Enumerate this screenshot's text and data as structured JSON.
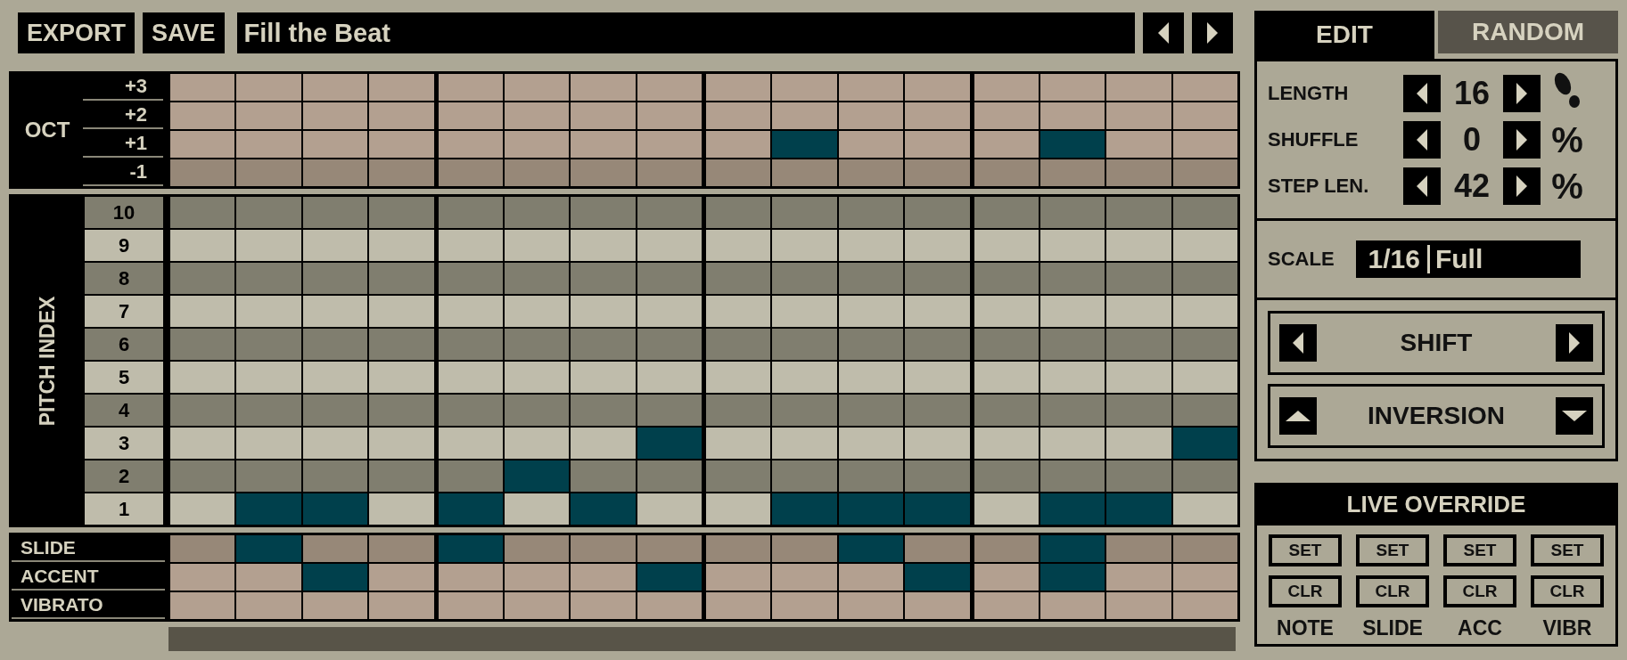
{
  "toolbar": {
    "buttons": [
      "EXPORT",
      "SAVE"
    ],
    "pattern_name": "Fill the Beat"
  },
  "octave": {
    "label": "OCT",
    "rows": [
      {
        "label": "+3",
        "kind": "light",
        "steps": [
          false,
          false,
          false,
          false,
          false,
          false,
          false,
          false,
          false,
          false,
          false,
          false,
          false,
          false,
          false,
          false
        ]
      },
      {
        "label": "+2",
        "kind": "light",
        "steps": [
          false,
          false,
          false,
          false,
          false,
          false,
          false,
          false,
          false,
          false,
          false,
          false,
          false,
          false,
          false,
          false
        ]
      },
      {
        "label": "+1",
        "kind": "light",
        "steps": [
          false,
          false,
          false,
          false,
          false,
          false,
          false,
          false,
          false,
          true,
          false,
          false,
          false,
          true,
          false,
          false
        ]
      },
      {
        "label": "-1",
        "kind": "dark",
        "steps": [
          false,
          false,
          false,
          false,
          false,
          false,
          false,
          false,
          false,
          false,
          false,
          false,
          false,
          false,
          false,
          false
        ]
      }
    ]
  },
  "pitch": {
    "label": "PITCH INDEX",
    "rows": [
      {
        "label": "10",
        "kind": "dark",
        "steps": [
          false,
          false,
          false,
          false,
          false,
          false,
          false,
          false,
          false,
          false,
          false,
          false,
          false,
          false,
          false,
          false
        ]
      },
      {
        "label": "9",
        "kind": "light",
        "steps": [
          false,
          false,
          false,
          false,
          false,
          false,
          false,
          false,
          false,
          false,
          false,
          false,
          false,
          false,
          false,
          false
        ]
      },
      {
        "label": "8",
        "kind": "dark",
        "steps": [
          false,
          false,
          false,
          false,
          false,
          false,
          false,
          false,
          false,
          false,
          false,
          false,
          false,
          false,
          false,
          false
        ]
      },
      {
        "label": "7",
        "kind": "light",
        "steps": [
          false,
          false,
          false,
          false,
          false,
          false,
          false,
          false,
          false,
          false,
          false,
          false,
          false,
          false,
          false,
          false
        ]
      },
      {
        "label": "6",
        "kind": "dark",
        "steps": [
          false,
          false,
          false,
          false,
          false,
          false,
          false,
          false,
          false,
          false,
          false,
          false,
          false,
          false,
          false,
          false
        ]
      },
      {
        "label": "5",
        "kind": "light",
        "steps": [
          false,
          false,
          false,
          false,
          false,
          false,
          false,
          false,
          false,
          false,
          false,
          false,
          false,
          false,
          false,
          false
        ]
      },
      {
        "label": "4",
        "kind": "dark",
        "steps": [
          false,
          false,
          false,
          false,
          false,
          false,
          false,
          false,
          false,
          false,
          false,
          false,
          false,
          false,
          false,
          false
        ]
      },
      {
        "label": "3",
        "kind": "light",
        "steps": [
          false,
          false,
          false,
          false,
          false,
          false,
          false,
          true,
          false,
          false,
          false,
          false,
          false,
          false,
          false,
          true
        ]
      },
      {
        "label": "2",
        "kind": "dark",
        "steps": [
          false,
          false,
          false,
          false,
          false,
          true,
          false,
          false,
          false,
          false,
          false,
          false,
          false,
          false,
          false,
          false
        ]
      },
      {
        "label": "1",
        "kind": "light",
        "steps": [
          false,
          true,
          true,
          false,
          true,
          false,
          true,
          false,
          false,
          true,
          true,
          true,
          false,
          true,
          true,
          false
        ]
      }
    ]
  },
  "modifiers": {
    "rows": [
      {
        "label": "SLIDE",
        "kind": "dark",
        "steps": [
          false,
          true,
          false,
          false,
          true,
          false,
          false,
          false,
          false,
          false,
          true,
          false,
          false,
          true,
          false,
          false
        ]
      },
      {
        "label": "ACCENT",
        "kind": "light",
        "steps": [
          false,
          false,
          true,
          false,
          false,
          false,
          false,
          true,
          false,
          false,
          false,
          true,
          false,
          true,
          false,
          false
        ]
      },
      {
        "label": "VIBRATO",
        "kind": "light",
        "steps": [
          false,
          false,
          false,
          false,
          false,
          false,
          false,
          false,
          false,
          false,
          false,
          false,
          false,
          false,
          false,
          false
        ]
      }
    ]
  },
  "tabs": [
    {
      "label": "EDIT",
      "selected": true
    },
    {
      "label": "RANDOM",
      "selected": false
    }
  ],
  "params": [
    {
      "label": "LENGTH",
      "value": "16",
      "kind": "steps"
    },
    {
      "label": "SHUFFLE",
      "value": "0",
      "kind": "percent",
      "unit": "%"
    },
    {
      "label": "STEP LEN.",
      "value": "42",
      "kind": "percent",
      "unit": "%"
    }
  ],
  "scale": {
    "label": "SCALE",
    "resolution": "1/16",
    "mode": "Full"
  },
  "transforms": [
    {
      "label": "SHIFT",
      "kind": "horizontal"
    },
    {
      "label": "INVERSION",
      "kind": "vertical"
    }
  ],
  "live_override": {
    "title": "LIVE OVERRIDE",
    "columns": [
      {
        "label": "NOTE",
        "set": "SET",
        "clear": "CLR"
      },
      {
        "label": "SLIDE",
        "set": "SET",
        "clear": "CLR"
      },
      {
        "label": "ACC",
        "set": "SET",
        "clear": "CLR"
      },
      {
        "label": "VIBR",
        "set": "SET",
        "clear": "CLR"
      }
    ]
  }
}
